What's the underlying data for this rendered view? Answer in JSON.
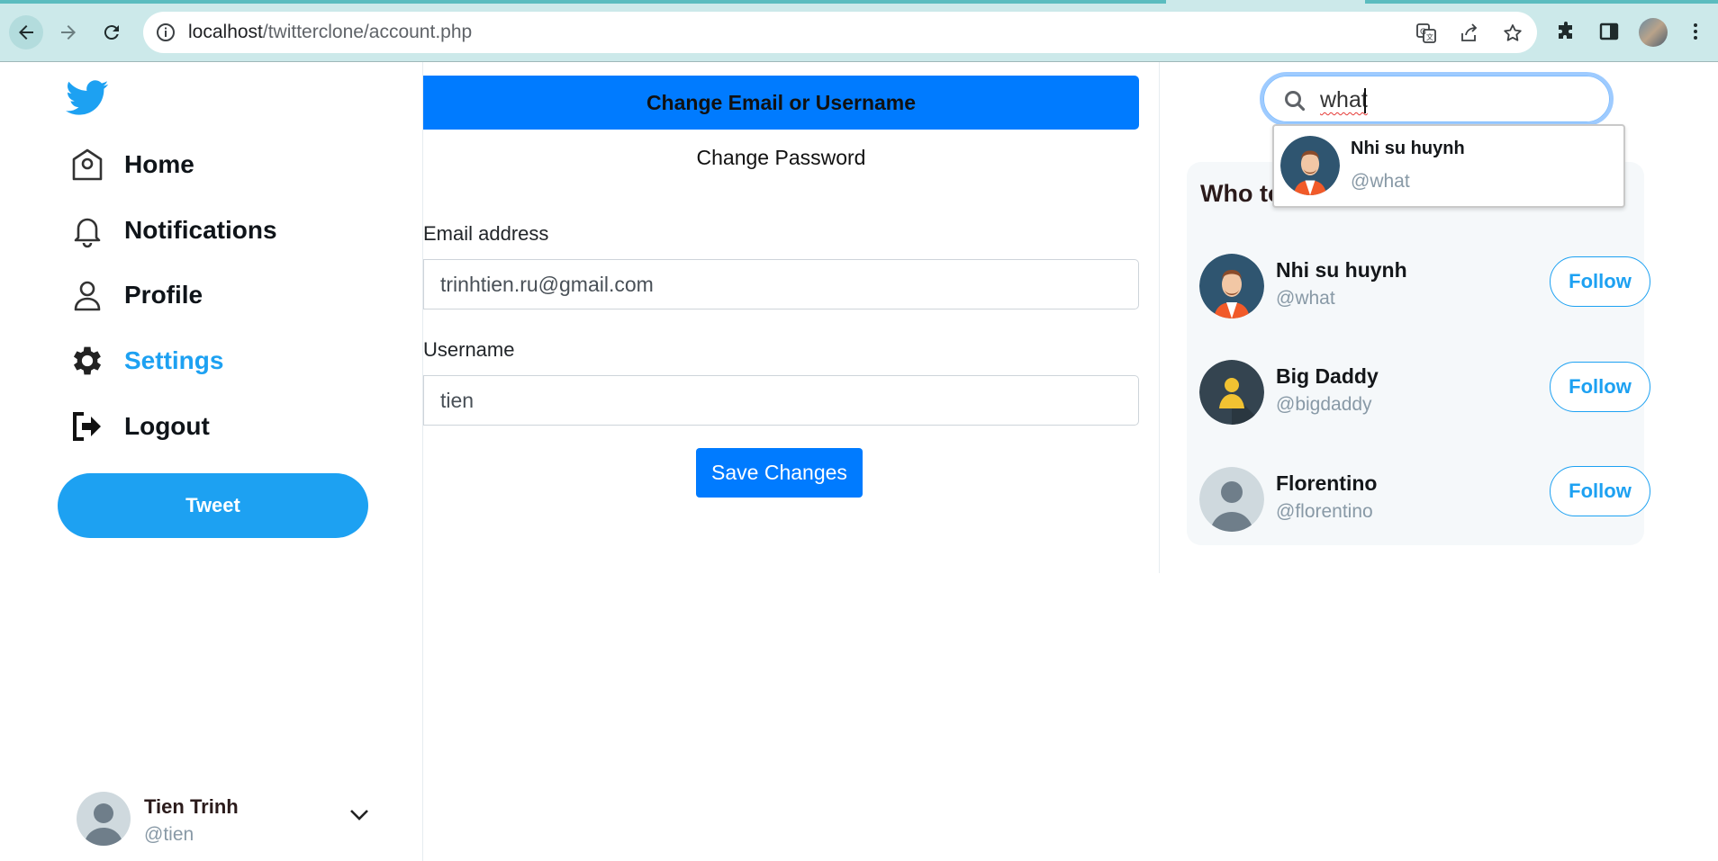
{
  "browser": {
    "url_host": "localhost",
    "url_path": "/twitterclone/account.php",
    "icons": [
      "back-icon",
      "forward-icon",
      "reload-icon",
      "site-info-icon",
      "translate-icon",
      "share-icon",
      "star-icon",
      "extensions-icon",
      "side-panel-icon",
      "menu-dots-icon"
    ]
  },
  "sidebar": {
    "items": [
      {
        "label": "Home",
        "icon": "home-icon"
      },
      {
        "label": "Notifications",
        "icon": "bell-icon"
      },
      {
        "label": "Profile",
        "icon": "person-icon"
      },
      {
        "label": "Settings",
        "icon": "gear-icon",
        "active": true
      },
      {
        "label": "Logout",
        "icon": "logout-icon"
      }
    ],
    "tweet_label": "Tweet",
    "account": {
      "name": "Tien Trinh",
      "handle": "@tien"
    }
  },
  "main": {
    "tab_active": "Change Email or Username",
    "tab_other": "Change Password",
    "email_label": "Email address",
    "email_value": "trinhtien.ru@gmail.com",
    "username_label": "Username",
    "username_value": "tien",
    "save_label": "Save Changes"
  },
  "search": {
    "query": "what",
    "result": {
      "name": "Nhi su huynh",
      "handle": "@what"
    }
  },
  "who_to_follow": {
    "title": "Who to follow",
    "users": [
      {
        "name": "Nhi su huynh",
        "handle": "@what",
        "follow_label": "Follow"
      },
      {
        "name": "Big Daddy",
        "handle": "@bigdaddy",
        "follow_label": "Follow"
      },
      {
        "name": "Florentino",
        "handle": "@florentino",
        "follow_label": "Follow"
      }
    ]
  },
  "colors": {
    "accent": "#1da1f2",
    "primary_button": "#007bff",
    "chrome_bg": "#cce9ea"
  }
}
